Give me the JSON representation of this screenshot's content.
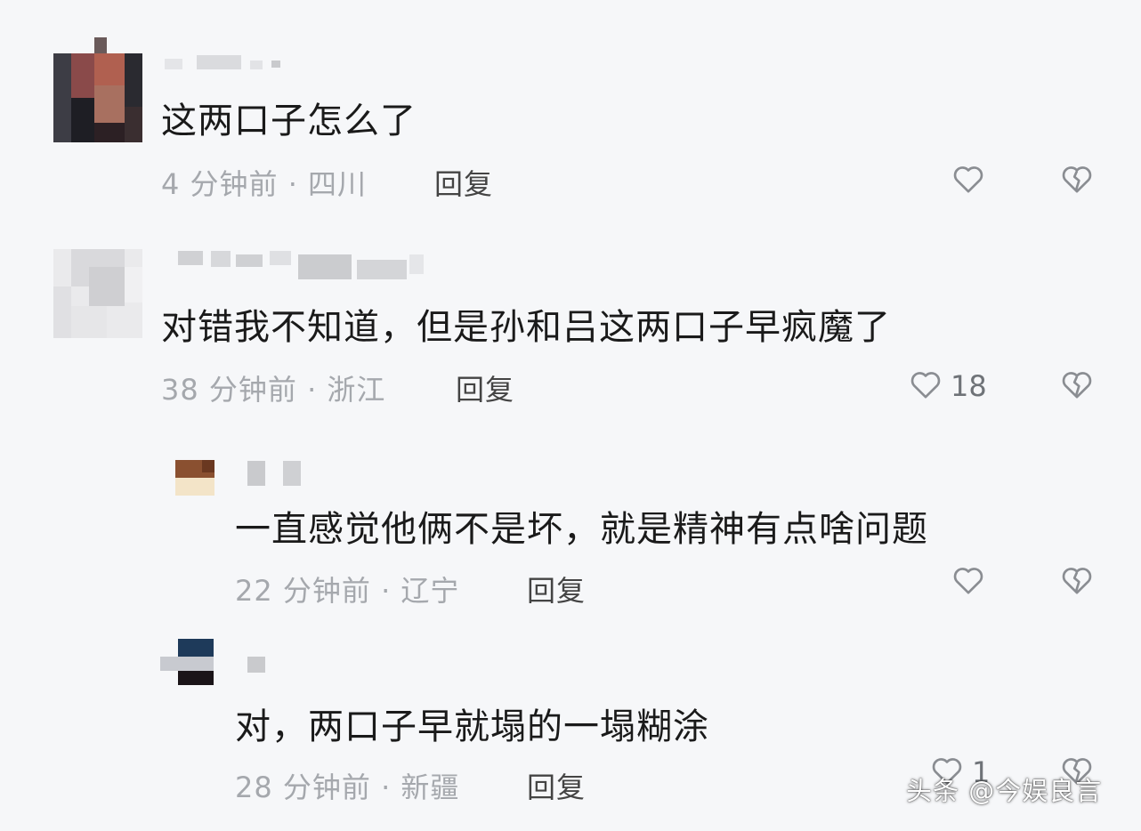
{
  "comments": [
    {
      "text": "这两口子怎么了",
      "time_location": "4 分钟前 · 四川",
      "reply_label": "回复",
      "like_count": ""
    },
    {
      "text": "对错我不知道，但是孙和吕这两口子早疯魔了",
      "time_location": "38 分钟前 · 浙江",
      "reply_label": "回复",
      "like_count": "18"
    },
    {
      "text": "一直感觉他俩不是坏，就是精神有点啥问题",
      "time_location": "22 分钟前 · 辽宁",
      "reply_label": "回复",
      "like_count": ""
    },
    {
      "text": "对，两口子早就塌的一塌糊涂",
      "time_location": "28 分钟前 · 新疆",
      "reply_label": "回复",
      "like_count": "1"
    }
  ],
  "icons": {
    "like": "heart-outline-icon",
    "dislike": "broken-heart-icon"
  },
  "colors": {
    "background": "#f6f7f9",
    "text": "#1a1a1a",
    "meta": "#a5a8ad",
    "icon": "#8a8d92"
  },
  "watermark": {
    "text": "头条 @今娱良言"
  }
}
